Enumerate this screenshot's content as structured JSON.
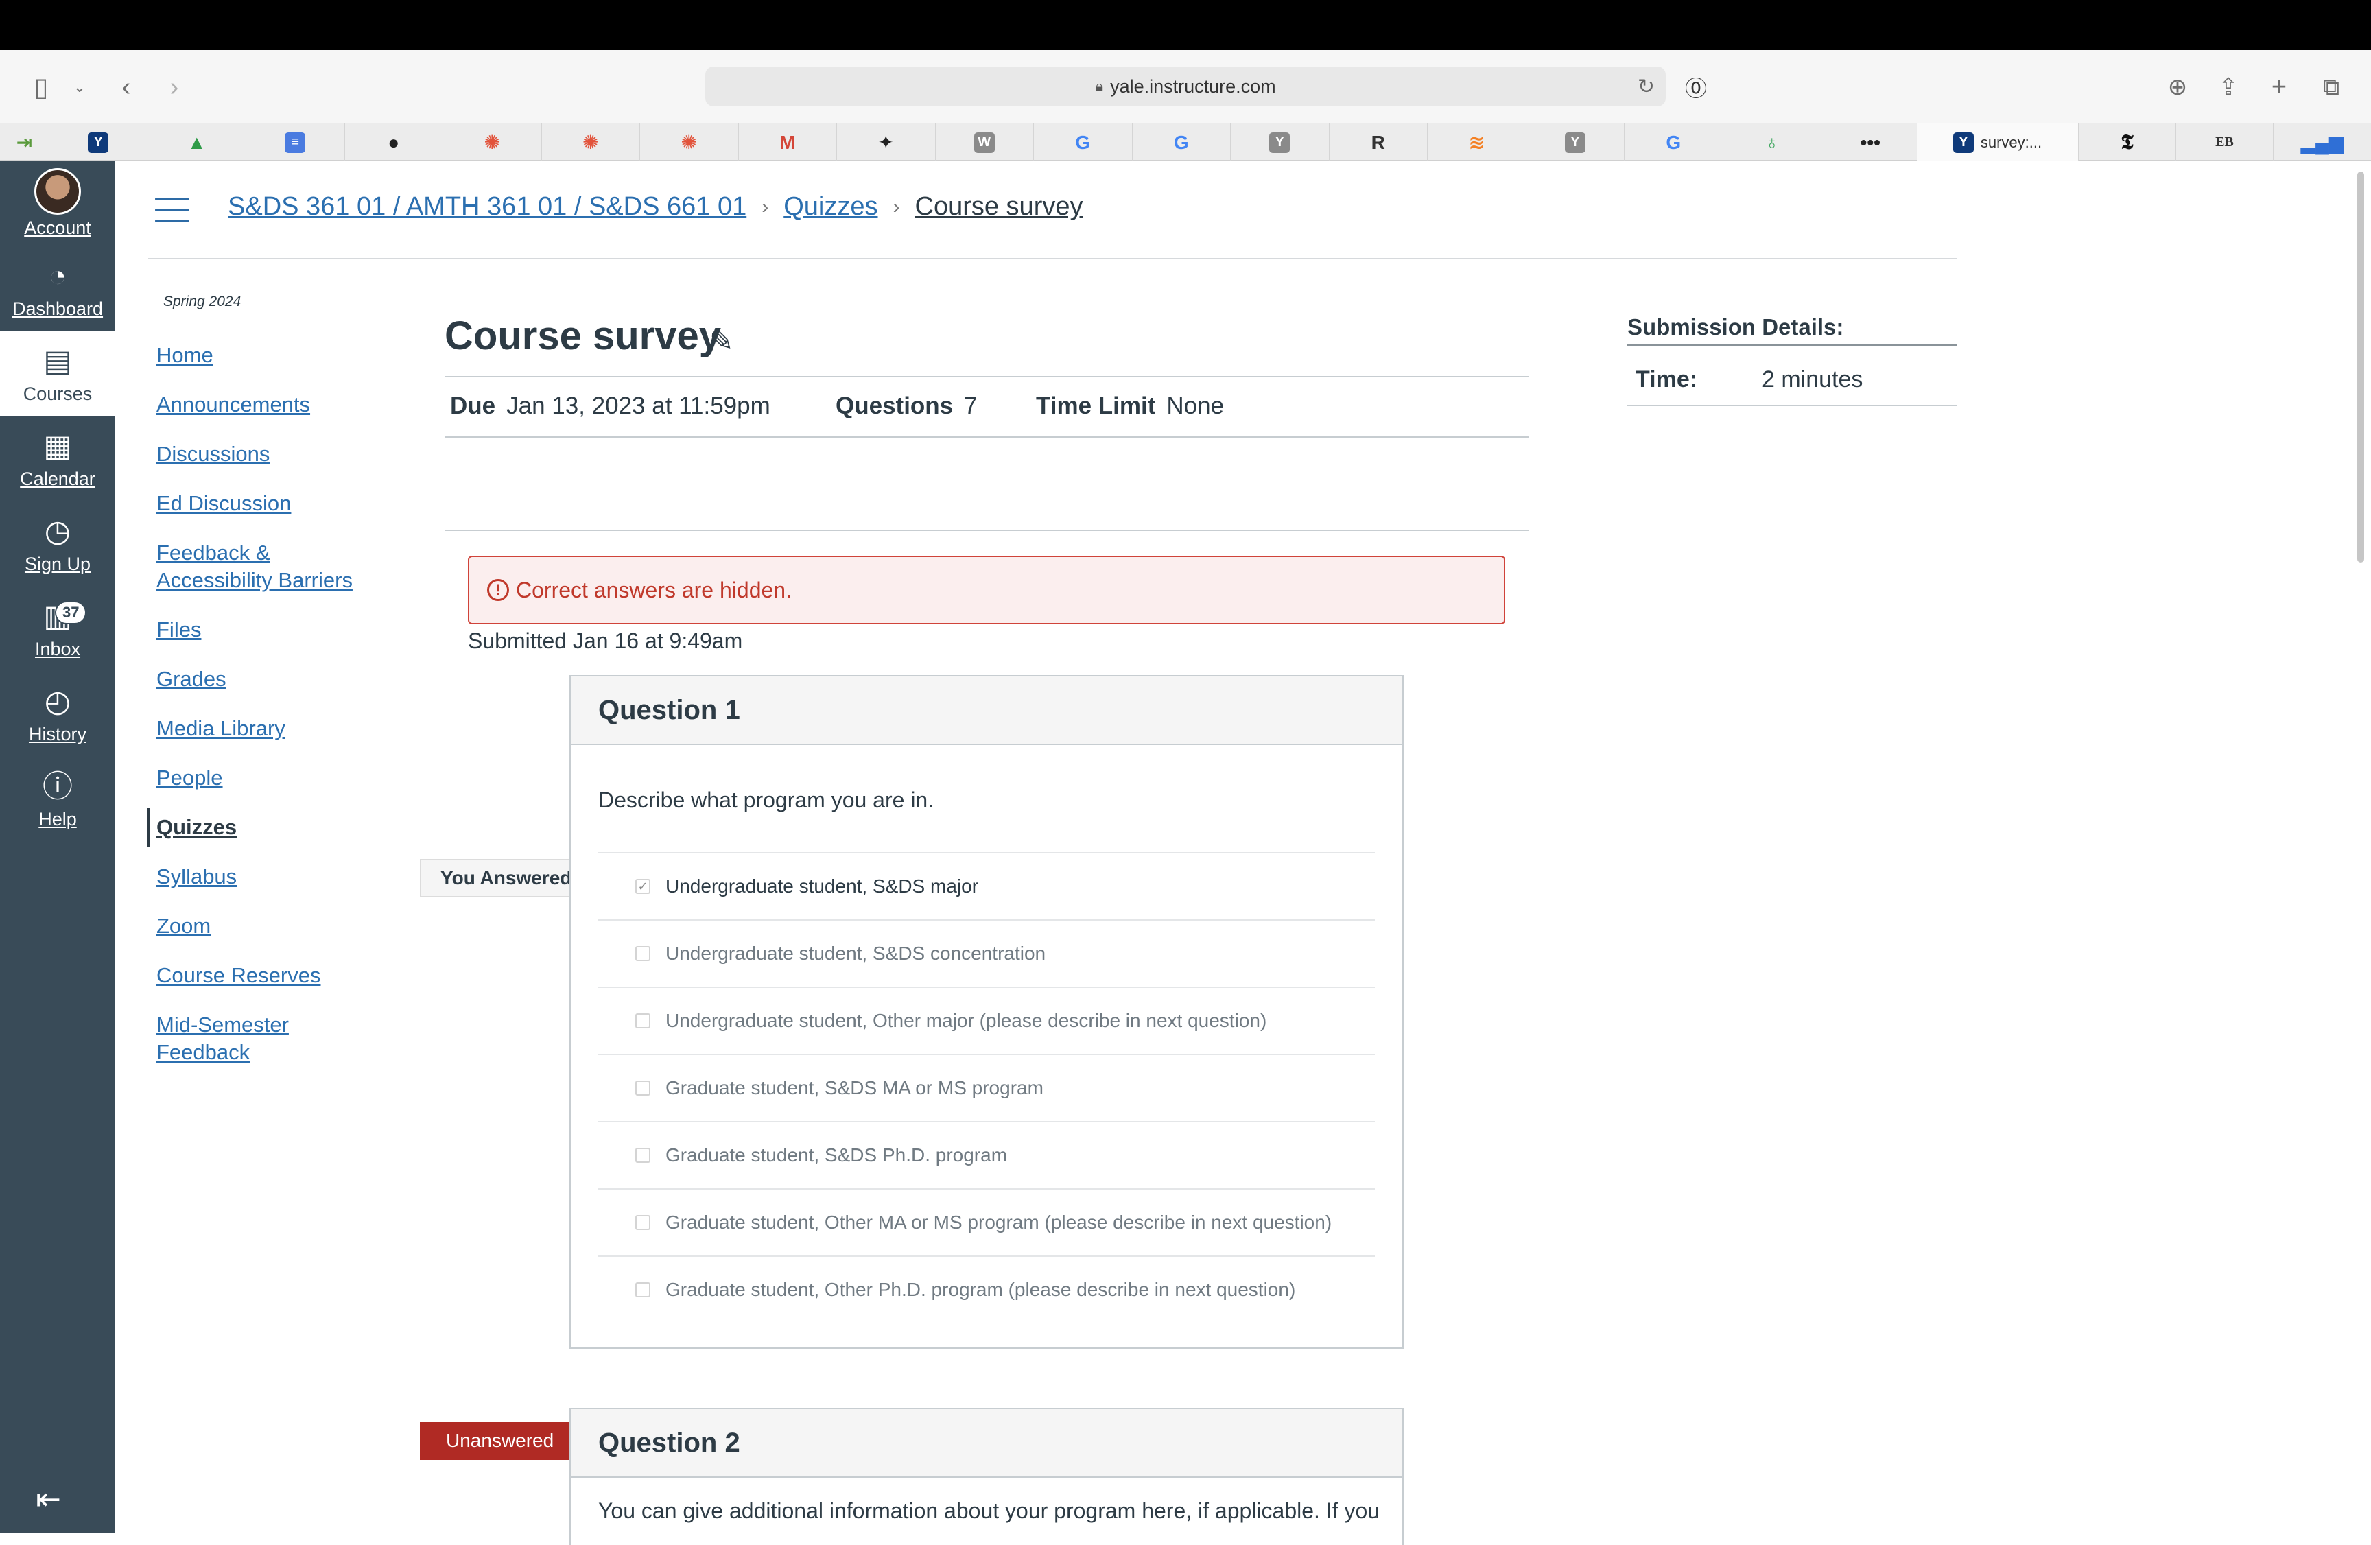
{
  "browser": {
    "url": "yale.instructure.com",
    "tabs": [
      {
        "icon": "back-arrow-tab-icon",
        "color": "#5a9a3c"
      },
      {
        "icon": "yale-icon",
        "color": "#0f3a7a"
      },
      {
        "icon": "google-drive-icon",
        "color": "#2f9b48"
      },
      {
        "icon": "google-docs-icon",
        "color": "#4a7be0"
      },
      {
        "icon": "github-icon",
        "color": "#222222"
      },
      {
        "icon": "canvas-icon",
        "color": "#e2533b"
      },
      {
        "icon": "canvas-icon",
        "color": "#e2533b"
      },
      {
        "icon": "canvas-icon",
        "color": "#e2533b"
      },
      {
        "icon": "gmail-icon",
        "color": "#d44638"
      },
      {
        "icon": "pinwheel-icon",
        "color": "#222222"
      },
      {
        "icon": "w-icon",
        "color": "#8a8a8a"
      },
      {
        "icon": "google-icon",
        "color": "#4285f4"
      },
      {
        "icon": "google-icon",
        "color": "#4285f4"
      },
      {
        "icon": "y-icon",
        "color": "#8a8a8a"
      },
      {
        "icon": "r-icon",
        "color": "#333333"
      },
      {
        "icon": "stackoverflow-icon",
        "color": "#f48024"
      },
      {
        "icon": "y-icon",
        "color": "#8a8a8a"
      },
      {
        "icon": "google-icon",
        "color": "#4285f4"
      },
      {
        "icon": "sprout-icon",
        "color": "#3ba55c"
      },
      {
        "icon": "more-icon",
        "color": "#222222"
      }
    ],
    "active_tab": {
      "title": "survey:..."
    },
    "right_tabs": [
      {
        "icon": "nyt-icon",
        "color": "#111111"
      },
      {
        "icon": "eb-icon",
        "label": "EB",
        "color": "#333333"
      },
      {
        "icon": "bar-chart-icon",
        "color": "#2f6fd6"
      }
    ]
  },
  "global_nav": {
    "items": [
      {
        "label": "Account",
        "icon": "avatar"
      },
      {
        "label": "Dashboard",
        "icon": "dashboard-icon"
      },
      {
        "label": "Courses",
        "icon": "courses-icon",
        "active": true
      },
      {
        "label": "Calendar",
        "icon": "calendar-icon"
      },
      {
        "label": "Sign Up",
        "icon": "signup-icon"
      },
      {
        "label": "Inbox",
        "icon": "inbox-icon",
        "badge": "37"
      },
      {
        "label": "History",
        "icon": "history-icon"
      },
      {
        "label": "Help",
        "icon": "help-icon"
      }
    ]
  },
  "breadcrumb": {
    "course": "S&DS 361 01 / AMTH 361 01 / S&DS 661 01",
    "section": "Quizzes",
    "current": "Course survey"
  },
  "course_nav": {
    "term": "Spring 2024",
    "items": [
      "Home",
      "Announcements",
      "Discussions",
      "Ed Discussion",
      "Feedback &",
      "Accessibility Barriers",
      "Files",
      "Grades",
      "Media Library",
      "People",
      "Quizzes",
      "Syllabus",
      "Zoom",
      "Course Reserves",
      "Mid-Semester",
      "Feedback"
    ]
  },
  "quiz": {
    "title": "Course survey",
    "due_label": "Due",
    "due_value": "Jan 13, 2023 at 11:59pm",
    "questions_label": "Questions",
    "questions_value": "7",
    "time_limit_label": "Time Limit",
    "time_limit_value": "None",
    "alert": "Correct answers are hidden.",
    "submitted": "Submitted Jan 16 at 9:49am"
  },
  "submission_details": {
    "heading": "Submission Details:",
    "time_label": "Time:",
    "time_value": "2 minutes"
  },
  "question1": {
    "title": "Question 1",
    "flag": "You Answered",
    "prompt": "Describe what program you are in.",
    "answers": [
      {
        "text": "Undergraduate student, S&DS major",
        "selected": true
      },
      {
        "text": "Undergraduate student, S&DS concentration",
        "selected": false
      },
      {
        "text": "Undergraduate student, Other major (please describe in next question)",
        "selected": false
      },
      {
        "text": "Graduate student, S&DS MA or MS program",
        "selected": false
      },
      {
        "text": "Graduate student, S&DS Ph.D. program",
        "selected": false
      },
      {
        "text": "Graduate student, Other MA or MS program (please describe in next question)",
        "selected": false
      },
      {
        "text": "Graduate student, Other Ph.D. program (please describe in next question)",
        "selected": false
      }
    ]
  },
  "question2": {
    "title": "Question 2",
    "flag": "Unanswered",
    "prompt": "You can give additional information about your program here, if applicable. If you"
  }
}
